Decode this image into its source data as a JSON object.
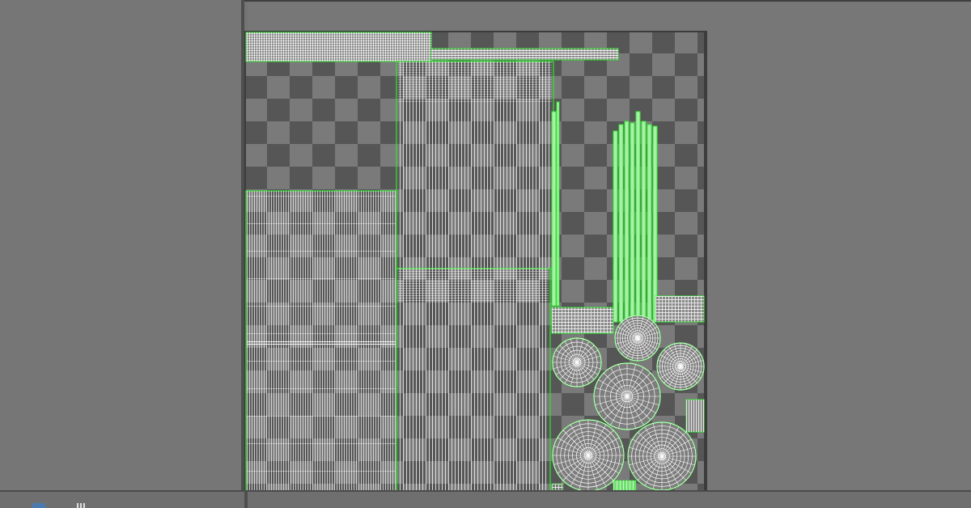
{
  "window": {
    "left_panel": "outliner-panel",
    "viewport": "uv-editor-viewport"
  },
  "colors": {
    "background": "#747474",
    "checker_dark": "#575757",
    "checker_light": "#7a7a7a",
    "wire": "#ffffff",
    "uv_border": "#2eea2e",
    "uv_fill": "#a8f0a8",
    "frame": "#3c3c3c"
  },
  "icons": {
    "status_icon": "panel-toggle-icon",
    "status_icon2": "grid-icon"
  },
  "uv_shells": [
    {
      "name": "top-strip-shell"
    },
    {
      "name": "top-thin-strip-shell"
    },
    {
      "name": "center-tall-shell"
    },
    {
      "name": "left-large-shell"
    },
    {
      "name": "center-bottom-shell"
    },
    {
      "name": "narrow-strip-shells"
    },
    {
      "name": "column-strip-shells"
    },
    {
      "name": "small-grid-shells"
    },
    {
      "name": "disc-shells"
    }
  ]
}
